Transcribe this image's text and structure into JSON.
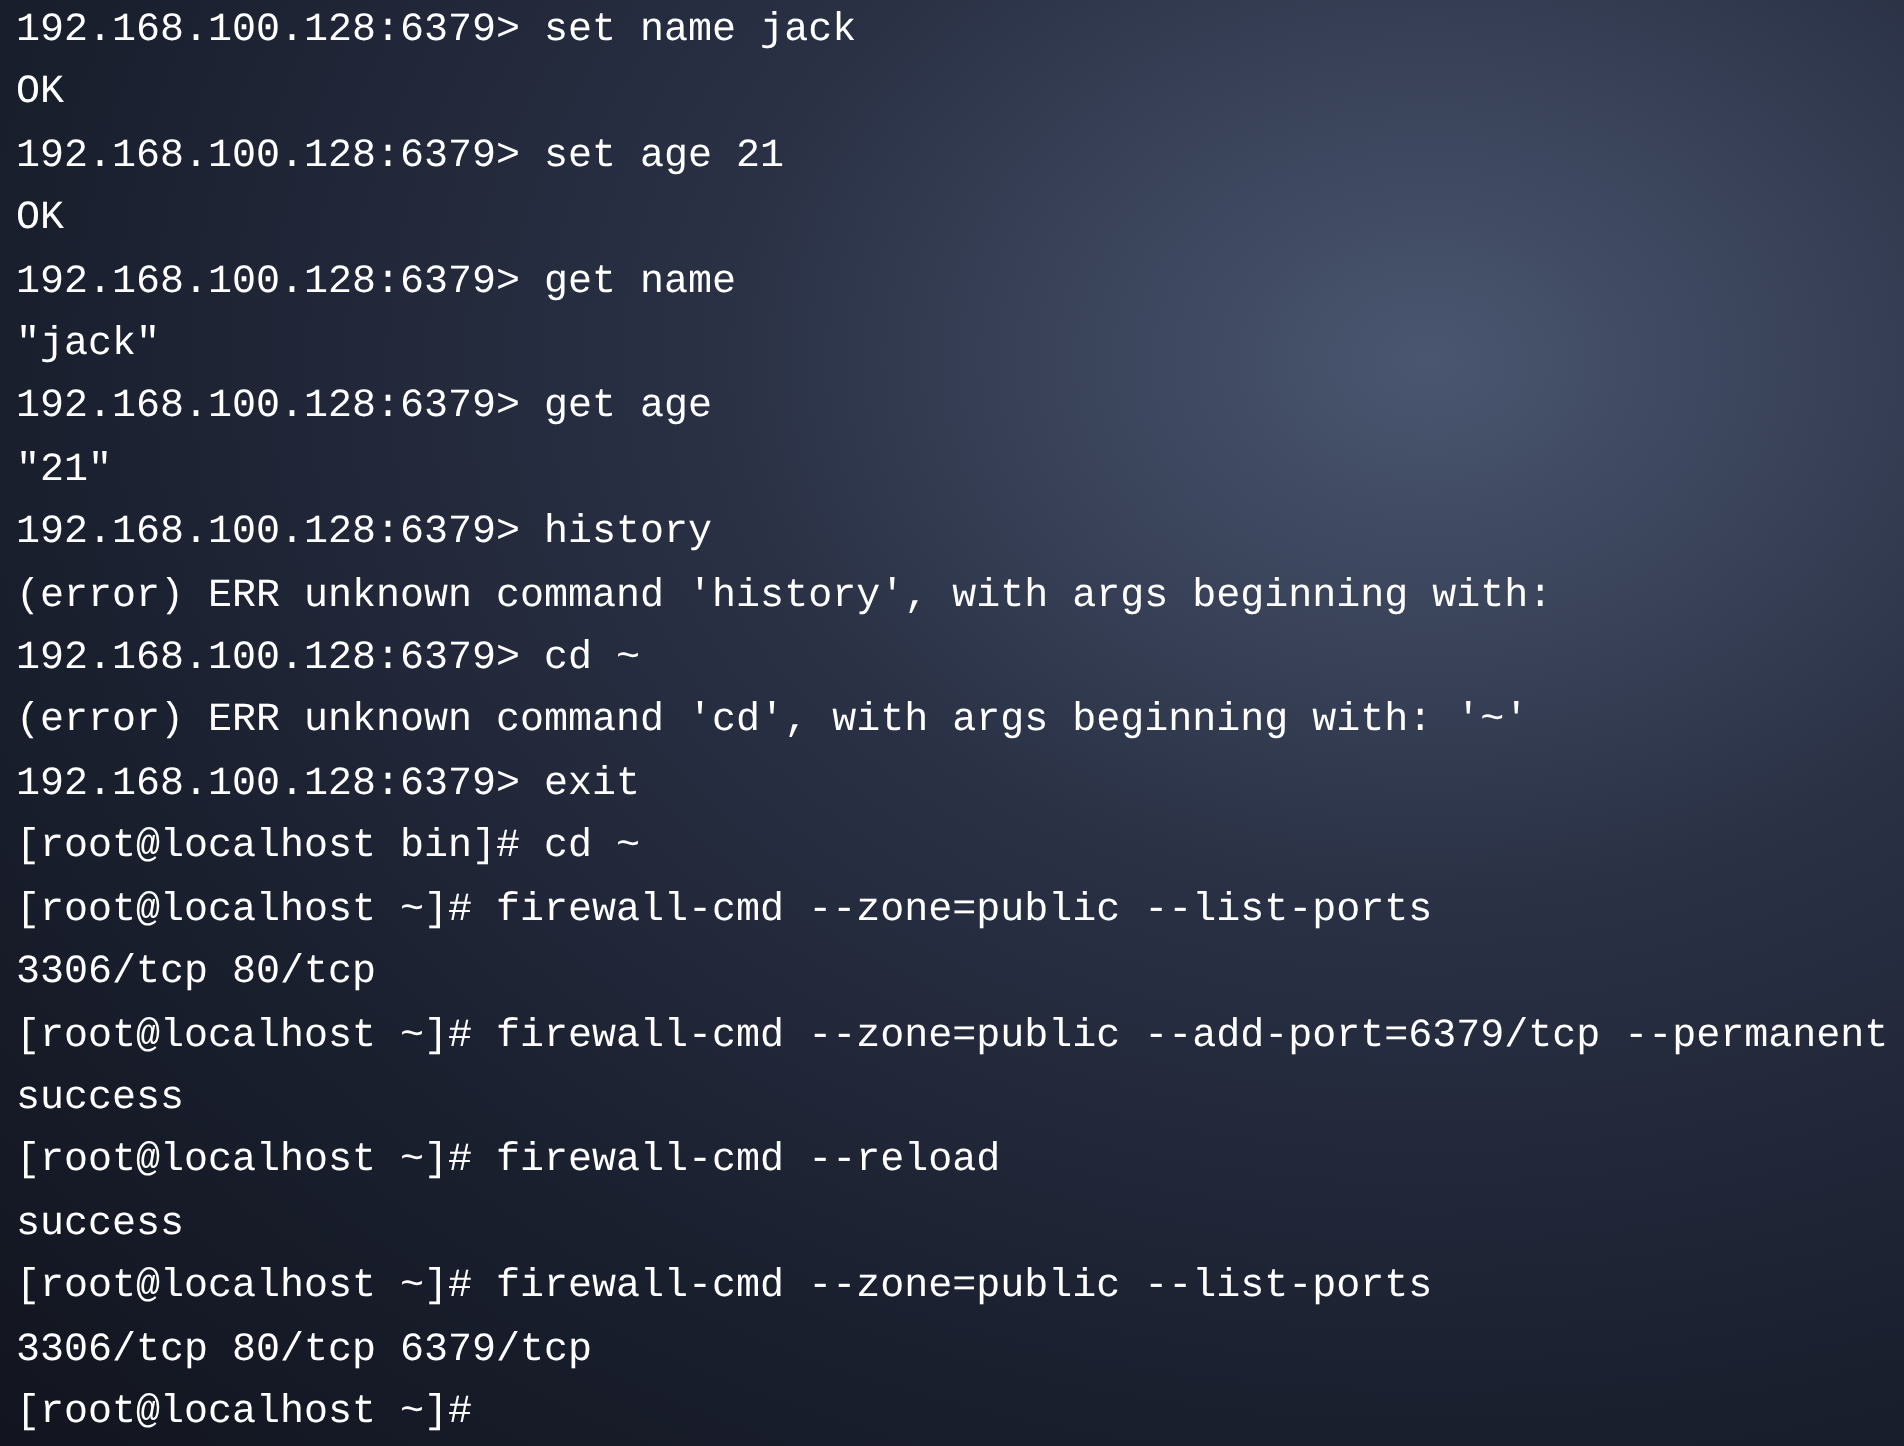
{
  "terminal": {
    "lines": [
      "192.168.100.128:6379> set name jack",
      "OK",
      "192.168.100.128:6379> set age 21",
      "OK",
      "192.168.100.128:6379> get name",
      "\"jack\"",
      "192.168.100.128:6379> get age",
      "\"21\"",
      "192.168.100.128:6379> history",
      "(error) ERR unknown command 'history', with args beginning with:",
      "192.168.100.128:6379> cd ~",
      "(error) ERR unknown command 'cd', with args beginning with: '~'",
      "192.168.100.128:6379> exit",
      "[root@localhost bin]# cd ~",
      "[root@localhost ~]# firewall-cmd --zone=public --list-ports",
      "3306/tcp 80/tcp",
      "[root@localhost ~]# firewall-cmd --zone=public --add-port=6379/tcp --permanent",
      "success",
      "[root@localhost ~]# firewall-cmd --reload",
      "success",
      "[root@localhost ~]# firewall-cmd --zone=public --list-ports",
      "3306/tcp 80/tcp 6379/tcp",
      "[root@localhost ~]#"
    ]
  }
}
